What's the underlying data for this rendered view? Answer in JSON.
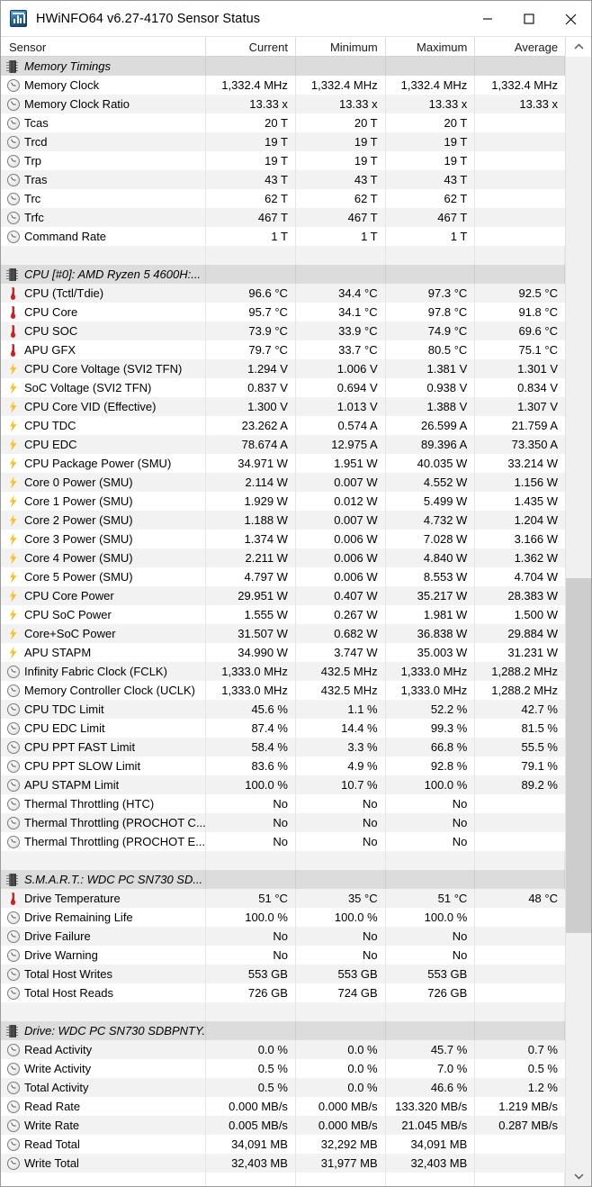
{
  "window": {
    "title": "HWiNFO64 v6.27-4170 Sensor Status",
    "icon": "hwinfo-app-icon",
    "minimize_label": "Minimize",
    "maximize_label": "Maximize",
    "close_label": "Close"
  },
  "columns": [
    "Sensor",
    "Current",
    "Minimum",
    "Maximum",
    "Average"
  ],
  "scrollbar": {
    "up_arrow": "chevron-up-icon",
    "down_arrow": "chevron-down-icon",
    "thumb_top_pct": 47.0,
    "thumb_height_pct": 32.0
  },
  "rows": [
    {
      "type": "group",
      "icon": "chip-icon",
      "name": "Memory Timings",
      "current": "",
      "minimum": "",
      "maximum": "",
      "average": ""
    },
    {
      "type": "sensor",
      "icon": "clock-icon",
      "name": "Memory Clock",
      "current": "1,332.4 MHz",
      "minimum": "1,332.4 MHz",
      "maximum": "1,332.4 MHz",
      "average": "1,332.4 MHz"
    },
    {
      "type": "sensor",
      "icon": "clock-icon",
      "name": "Memory Clock Ratio",
      "current": "13.33 x",
      "minimum": "13.33 x",
      "maximum": "13.33 x",
      "average": "13.33 x"
    },
    {
      "type": "sensor",
      "icon": "clock-icon",
      "name": "Tcas",
      "current": "20 T",
      "minimum": "20 T",
      "maximum": "20 T",
      "average": ""
    },
    {
      "type": "sensor",
      "icon": "clock-icon",
      "name": "Trcd",
      "current": "19 T",
      "minimum": "19 T",
      "maximum": "19 T",
      "average": ""
    },
    {
      "type": "sensor",
      "icon": "clock-icon",
      "name": "Trp",
      "current": "19 T",
      "minimum": "19 T",
      "maximum": "19 T",
      "average": ""
    },
    {
      "type": "sensor",
      "icon": "clock-icon",
      "name": "Tras",
      "current": "43 T",
      "minimum": "43 T",
      "maximum": "43 T",
      "average": ""
    },
    {
      "type": "sensor",
      "icon": "clock-icon",
      "name": "Trc",
      "current": "62 T",
      "minimum": "62 T",
      "maximum": "62 T",
      "average": ""
    },
    {
      "type": "sensor",
      "icon": "clock-icon",
      "name": "Trfc",
      "current": "467 T",
      "minimum": "467 T",
      "maximum": "467 T",
      "average": ""
    },
    {
      "type": "sensor",
      "icon": "clock-icon",
      "name": "Command Rate",
      "current": "1 T",
      "minimum": "1 T",
      "maximum": "1 T",
      "average": ""
    },
    {
      "type": "blank",
      "icon": "",
      "name": "",
      "current": "",
      "minimum": "",
      "maximum": "",
      "average": ""
    },
    {
      "type": "group",
      "icon": "chip-icon",
      "name": "CPU [#0]: AMD Ryzen 5 4600H:...",
      "current": "",
      "minimum": "",
      "maximum": "",
      "average": ""
    },
    {
      "type": "sensor",
      "icon": "thermometer-icon",
      "name": "CPU (Tctl/Tdie)",
      "current": "96.6 °C",
      "minimum": "34.4 °C",
      "maximum": "97.3 °C",
      "average": "92.5 °C"
    },
    {
      "type": "sensor",
      "icon": "thermometer-icon",
      "name": "CPU Core",
      "current": "95.7 °C",
      "minimum": "34.1 °C",
      "maximum": "97.8 °C",
      "average": "91.8 °C"
    },
    {
      "type": "sensor",
      "icon": "thermometer-icon",
      "name": "CPU SOC",
      "current": "73.9 °C",
      "minimum": "33.9 °C",
      "maximum": "74.9 °C",
      "average": "69.6 °C"
    },
    {
      "type": "sensor",
      "icon": "thermometer-icon",
      "name": "APU GFX",
      "current": "79.7 °C",
      "minimum": "33.7 °C",
      "maximum": "80.5 °C",
      "average": "75.1 °C"
    },
    {
      "type": "sensor",
      "icon": "bolt-icon",
      "name": "CPU Core Voltage (SVI2 TFN)",
      "current": "1.294 V",
      "minimum": "1.006 V",
      "maximum": "1.381 V",
      "average": "1.301 V"
    },
    {
      "type": "sensor",
      "icon": "bolt-icon",
      "name": "SoC Voltage (SVI2 TFN)",
      "current": "0.837 V",
      "minimum": "0.694 V",
      "maximum": "0.938 V",
      "average": "0.834 V"
    },
    {
      "type": "sensor",
      "icon": "bolt-icon",
      "name": "CPU Core VID (Effective)",
      "current": "1.300 V",
      "minimum": "1.013 V",
      "maximum": "1.388 V",
      "average": "1.307 V"
    },
    {
      "type": "sensor",
      "icon": "bolt-icon",
      "name": "CPU TDC",
      "current": "23.262 A",
      "minimum": "0.574 A",
      "maximum": "26.599 A",
      "average": "21.759 A"
    },
    {
      "type": "sensor",
      "icon": "bolt-icon",
      "name": "CPU EDC",
      "current": "78.674 A",
      "minimum": "12.975 A",
      "maximum": "89.396 A",
      "average": "73.350 A"
    },
    {
      "type": "sensor",
      "icon": "bolt-icon",
      "name": "CPU Package Power (SMU)",
      "current": "34.971 W",
      "minimum": "1.951 W",
      "maximum": "40.035 W",
      "average": "33.214 W"
    },
    {
      "type": "sensor",
      "icon": "bolt-icon",
      "name": "Core 0 Power (SMU)",
      "current": "2.114 W",
      "minimum": "0.007 W",
      "maximum": "4.552 W",
      "average": "1.156 W"
    },
    {
      "type": "sensor",
      "icon": "bolt-icon",
      "name": "Core 1 Power (SMU)",
      "current": "1.929 W",
      "minimum": "0.012 W",
      "maximum": "5.499 W",
      "average": "1.435 W"
    },
    {
      "type": "sensor",
      "icon": "bolt-icon",
      "name": "Core 2 Power (SMU)",
      "current": "1.188 W",
      "minimum": "0.007 W",
      "maximum": "4.732 W",
      "average": "1.204 W"
    },
    {
      "type": "sensor",
      "icon": "bolt-icon",
      "name": "Core 3 Power (SMU)",
      "current": "1.374 W",
      "minimum": "0.006 W",
      "maximum": "7.028 W",
      "average": "3.166 W"
    },
    {
      "type": "sensor",
      "icon": "bolt-icon",
      "name": "Core 4 Power (SMU)",
      "current": "2.211 W",
      "minimum": "0.006 W",
      "maximum": "4.840 W",
      "average": "1.362 W"
    },
    {
      "type": "sensor",
      "icon": "bolt-icon",
      "name": "Core 5 Power (SMU)",
      "current": "4.797 W",
      "minimum": "0.006 W",
      "maximum": "8.553 W",
      "average": "4.704 W"
    },
    {
      "type": "sensor",
      "icon": "bolt-icon",
      "name": "CPU Core Power",
      "current": "29.951 W",
      "minimum": "0.407 W",
      "maximum": "35.217 W",
      "average": "28.383 W"
    },
    {
      "type": "sensor",
      "icon": "bolt-icon",
      "name": "CPU SoC Power",
      "current": "1.555 W",
      "minimum": "0.267 W",
      "maximum": "1.981 W",
      "average": "1.500 W"
    },
    {
      "type": "sensor",
      "icon": "bolt-icon",
      "name": "Core+SoC Power",
      "current": "31.507 W",
      "minimum": "0.682 W",
      "maximum": "36.838 W",
      "average": "29.884 W"
    },
    {
      "type": "sensor",
      "icon": "bolt-icon",
      "name": "APU STAPM",
      "current": "34.990 W",
      "minimum": "3.747 W",
      "maximum": "35.003 W",
      "average": "31.231 W"
    },
    {
      "type": "sensor",
      "icon": "clock-icon",
      "name": "Infinity Fabric Clock (FCLK)",
      "current": "1,333.0 MHz",
      "minimum": "432.5 MHz",
      "maximum": "1,333.0 MHz",
      "average": "1,288.2 MHz"
    },
    {
      "type": "sensor",
      "icon": "clock-icon",
      "name": "Memory Controller Clock (UCLK)",
      "current": "1,333.0 MHz",
      "minimum": "432.5 MHz",
      "maximum": "1,333.0 MHz",
      "average": "1,288.2 MHz"
    },
    {
      "type": "sensor",
      "icon": "clock-icon",
      "name": "CPU TDC Limit",
      "current": "45.6 %",
      "minimum": "1.1 %",
      "maximum": "52.2 %",
      "average": "42.7 %"
    },
    {
      "type": "sensor",
      "icon": "clock-icon",
      "name": "CPU EDC Limit",
      "current": "87.4 %",
      "minimum": "14.4 %",
      "maximum": "99.3 %",
      "average": "81.5 %"
    },
    {
      "type": "sensor",
      "icon": "clock-icon",
      "name": "CPU PPT FAST Limit",
      "current": "58.4 %",
      "minimum": "3.3 %",
      "maximum": "66.8 %",
      "average": "55.5 %"
    },
    {
      "type": "sensor",
      "icon": "clock-icon",
      "name": "CPU PPT SLOW Limit",
      "current": "83.6 %",
      "minimum": "4.9 %",
      "maximum": "92.8 %",
      "average": "79.1 %"
    },
    {
      "type": "sensor",
      "icon": "clock-icon",
      "name": "APU STAPM Limit",
      "current": "100.0 %",
      "minimum": "10.7 %",
      "maximum": "100.0 %",
      "average": "89.2 %"
    },
    {
      "type": "sensor",
      "icon": "clock-icon",
      "name": "Thermal Throttling (HTC)",
      "current": "No",
      "minimum": "No",
      "maximum": "No",
      "average": ""
    },
    {
      "type": "sensor",
      "icon": "clock-icon",
      "name": "Thermal Throttling (PROCHOT C...",
      "current": "No",
      "minimum": "No",
      "maximum": "No",
      "average": ""
    },
    {
      "type": "sensor",
      "icon": "clock-icon",
      "name": "Thermal Throttling (PROCHOT E...",
      "current": "No",
      "minimum": "No",
      "maximum": "No",
      "average": ""
    },
    {
      "type": "blank",
      "icon": "",
      "name": "",
      "current": "",
      "minimum": "",
      "maximum": "",
      "average": ""
    },
    {
      "type": "group",
      "icon": "chip-icon",
      "name": "S.M.A.R.T.: WDC PC SN730 SD...",
      "current": "",
      "minimum": "",
      "maximum": "",
      "average": ""
    },
    {
      "type": "sensor",
      "icon": "thermometer-icon",
      "name": "Drive Temperature",
      "current": "51 °C",
      "minimum": "35 °C",
      "maximum": "51 °C",
      "average": "48 °C"
    },
    {
      "type": "sensor",
      "icon": "clock-icon",
      "name": "Drive Remaining Life",
      "current": "100.0 %",
      "minimum": "100.0 %",
      "maximum": "100.0 %",
      "average": ""
    },
    {
      "type": "sensor",
      "icon": "clock-icon",
      "name": "Drive Failure",
      "current": "No",
      "minimum": "No",
      "maximum": "No",
      "average": ""
    },
    {
      "type": "sensor",
      "icon": "clock-icon",
      "name": "Drive Warning",
      "current": "No",
      "minimum": "No",
      "maximum": "No",
      "average": ""
    },
    {
      "type": "sensor",
      "icon": "clock-icon",
      "name": "Total Host Writes",
      "current": "553 GB",
      "minimum": "553 GB",
      "maximum": "553 GB",
      "average": ""
    },
    {
      "type": "sensor",
      "icon": "clock-icon",
      "name": "Total Host Reads",
      "current": "726 GB",
      "minimum": "724 GB",
      "maximum": "726 GB",
      "average": ""
    },
    {
      "type": "blank",
      "icon": "",
      "name": "",
      "current": "",
      "minimum": "",
      "maximum": "",
      "average": ""
    },
    {
      "type": "group",
      "icon": "chip-icon",
      "name": "Drive: WDC PC SN730 SDBPNTY...",
      "current": "",
      "minimum": "",
      "maximum": "",
      "average": ""
    },
    {
      "type": "sensor",
      "icon": "clock-icon",
      "name": "Read Activity",
      "current": "0.0 %",
      "minimum": "0.0 %",
      "maximum": "45.7 %",
      "average": "0.7 %"
    },
    {
      "type": "sensor",
      "icon": "clock-icon",
      "name": "Write Activity",
      "current": "0.5 %",
      "minimum": "0.0 %",
      "maximum": "7.0 %",
      "average": "0.5 %"
    },
    {
      "type": "sensor",
      "icon": "clock-icon",
      "name": "Total Activity",
      "current": "0.5 %",
      "minimum": "0.0 %",
      "maximum": "46.6 %",
      "average": "1.2 %"
    },
    {
      "type": "sensor",
      "icon": "clock-icon",
      "name": "Read Rate",
      "current": "0.000 MB/s",
      "minimum": "0.000 MB/s",
      "maximum": "133.320 MB/s",
      "average": "1.219 MB/s"
    },
    {
      "type": "sensor",
      "icon": "clock-icon",
      "name": "Write Rate",
      "current": "0.005 MB/s",
      "minimum": "0.000 MB/s",
      "maximum": "21.045 MB/s",
      "average": "0.287 MB/s"
    },
    {
      "type": "sensor",
      "icon": "clock-icon",
      "name": "Read Total",
      "current": "34,091 MB",
      "minimum": "32,292 MB",
      "maximum": "34,091 MB",
      "average": ""
    },
    {
      "type": "sensor",
      "icon": "clock-icon",
      "name": "Write Total",
      "current": "32,403 MB",
      "minimum": "31,977 MB",
      "maximum": "32,403 MB",
      "average": ""
    },
    {
      "type": "blank",
      "icon": "",
      "name": "",
      "current": "",
      "minimum": "",
      "maximum": "",
      "average": ""
    }
  ]
}
